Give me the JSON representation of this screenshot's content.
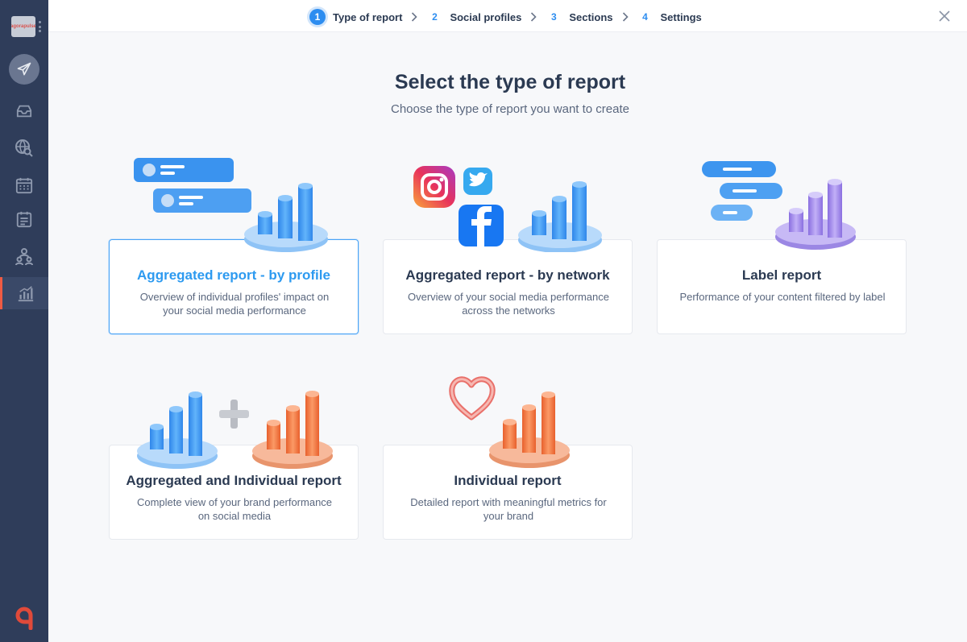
{
  "sidebar": {
    "logo_text": "agorapulse",
    "items": [
      {
        "name": "inbox"
      },
      {
        "name": "listening"
      },
      {
        "name": "calendar"
      },
      {
        "name": "publishing-list"
      },
      {
        "name": "team"
      },
      {
        "name": "reports"
      }
    ]
  },
  "stepper": {
    "steps": [
      {
        "num": "1",
        "label": "Type of report"
      },
      {
        "num": "2",
        "label": "Social profiles"
      },
      {
        "num": "3",
        "label": "Sections"
      },
      {
        "num": "4",
        "label": "Settings"
      }
    ]
  },
  "main": {
    "title": "Select the type of report",
    "subtitle": "Choose the type of report you want to create"
  },
  "cards": [
    {
      "title": "Aggregated report - by profile",
      "desc": "Overview of individual profiles' impact on your social media performance"
    },
    {
      "title": "Aggregated report - by network",
      "desc": "Overview of your social media performance across the networks"
    },
    {
      "title": "Label report",
      "desc": "Performance of your content filtered by label"
    },
    {
      "title": "Aggregated and Individual report",
      "desc": "Complete view of your brand performance on social media"
    },
    {
      "title": "Individual report",
      "desc": "Detailed report with meaningful metrics for your brand"
    }
  ],
  "colors": {
    "sidebar": "#2f3d5a",
    "accent": "#2d8df0",
    "active_marker": "#ef5b43",
    "blue_chart": "#4ea6f7",
    "orange_chart": "#f27a44",
    "purple_chart": "#a48ee8"
  },
  "icons": [
    "paper-plane-icon",
    "inbox-icon",
    "globe-search-icon",
    "calendar-icon",
    "clipboard-list-icon",
    "team-icon",
    "bar-chart-icon",
    "chevron-right-icon",
    "close-icon",
    "instagram-icon",
    "twitter-icon",
    "facebook-icon",
    "heart-icon",
    "plus-icon"
  ]
}
